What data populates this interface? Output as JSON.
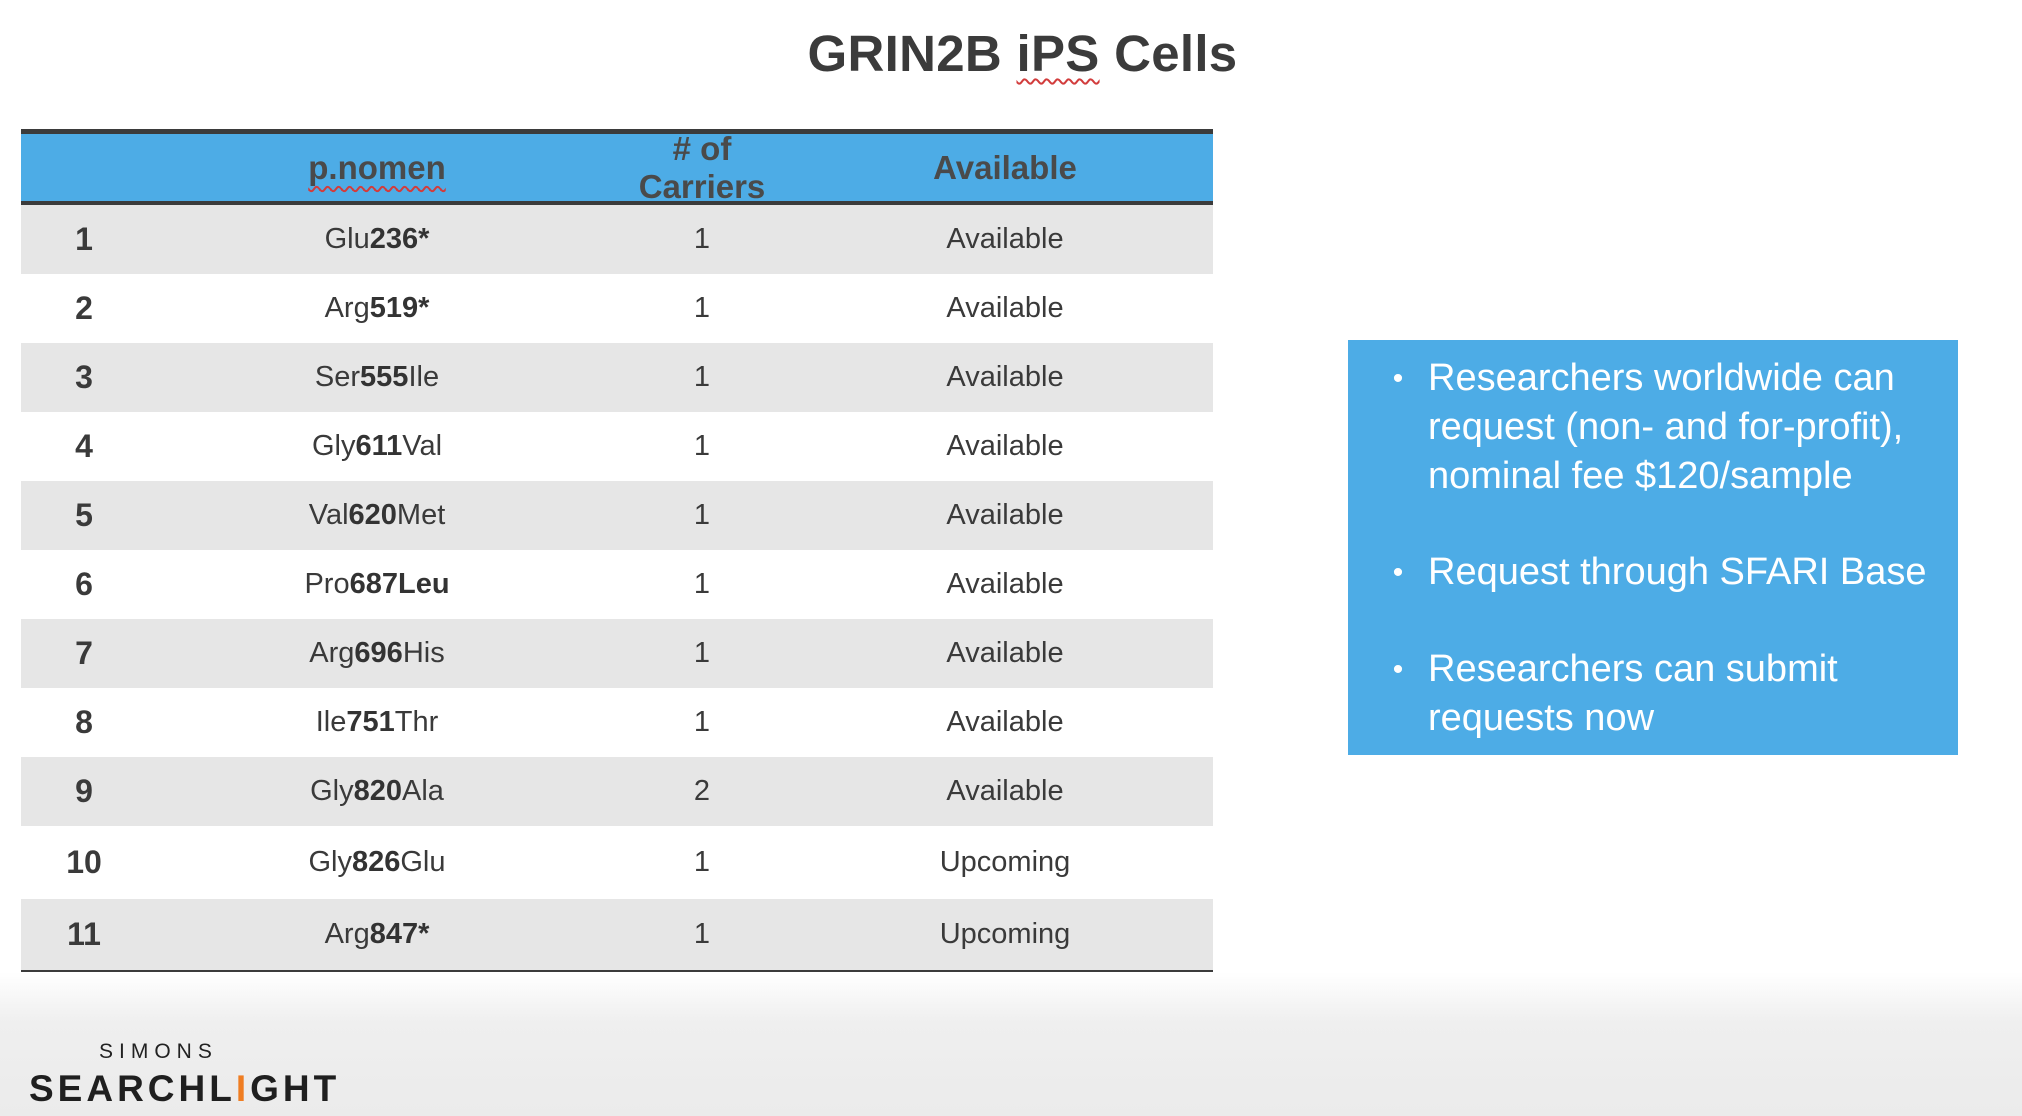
{
  "slide": {
    "title_part1": "GRIN2B ",
    "title_part2": "iPS",
    "title_part3": " Cells"
  },
  "table": {
    "headers": {
      "index": "",
      "pnomen": "p.nomen",
      "carriers": "# of Carriers",
      "available": "Available"
    },
    "rows": [
      {
        "index": "1",
        "pre": "Glu",
        "pos": "236",
        "post": "*",
        "carriers": "1",
        "status": "Available"
      },
      {
        "index": "2",
        "pre": "Arg",
        "pos": "519",
        "post": "*",
        "carriers": "1",
        "status": "Available"
      },
      {
        "index": "3",
        "pre": "Ser",
        "pos": "555",
        "post": "Ile",
        "carriers": "1",
        "status": "Available"
      },
      {
        "index": "4",
        "pre": "Gly",
        "pos": "611",
        "post": "Val",
        "carriers": "1",
        "status": "Available"
      },
      {
        "index": "5",
        "pre": "Val",
        "pos": "620",
        "post": "Met",
        "carriers": "1",
        "status": "Available"
      },
      {
        "index": "6",
        "pre": "Pro",
        "pos": "687",
        "post": "Leu",
        "carriers": "1",
        "status": "Available"
      },
      {
        "index": "7",
        "pre": "Arg",
        "pos": "696",
        "post": "His",
        "carriers": "1",
        "status": "Available"
      },
      {
        "index": "8",
        "pre": "Ile",
        "pos": "751",
        "post": "Thr",
        "carriers": "1",
        "status": "Available"
      },
      {
        "index": "9",
        "pre": "Gly",
        "pos": "820",
        "post": "Ala",
        "carriers": "2",
        "status": "Available"
      },
      {
        "index": "10",
        "pre": "Gly",
        "pos": "826",
        "post": "Glu",
        "carriers": "1",
        "status": "Upcoming"
      },
      {
        "index": "11",
        "pre": "Arg",
        "pos": "847",
        "post": "*",
        "carriers": "1",
        "status": "Upcoming"
      }
    ]
  },
  "info": {
    "bullet_symbol": "•",
    "bullets": [
      "Researchers worldwide can request (non- and for-profit), nominal fee $120/sample",
      "Request through SFARI Base",
      "Researchers can submit requests now"
    ]
  },
  "logo": {
    "top": "SIMONS",
    "main_a": "SEARCHL",
    "main_bolt": "I",
    "main_b": "GHT"
  },
  "colors": {
    "header_blue": "#4dace6",
    "stripe_gray": "#e6e6e6",
    "rule_dark": "#3b3b3b",
    "logo_accent": "#ef7d22"
  }
}
